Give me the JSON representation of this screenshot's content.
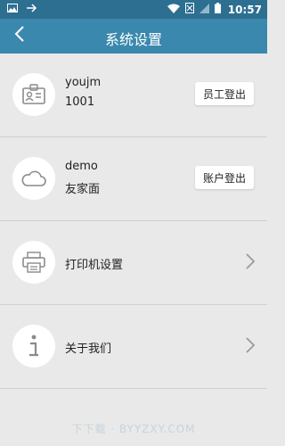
{
  "status_bar": {
    "time": "10:57",
    "icons": [
      "image-icon",
      "usb-icon",
      "wifi-icon",
      "sim-off-icon",
      "signal-icon",
      "battery-icon"
    ]
  },
  "header": {
    "title": "系统设置",
    "back_icon": "chevron-left-icon"
  },
  "items": [
    {
      "icon": "employee-card-icon",
      "line1": "youjm",
      "line2": "1001",
      "button": "员工登出"
    },
    {
      "icon": "cloud-icon",
      "line1": "demo",
      "line2": "友家面",
      "button": "账户登出"
    },
    {
      "icon": "printer-icon",
      "label": "打印机设置"
    },
    {
      "icon": "info-icon",
      "label": "关于我们"
    }
  ],
  "watermark": "下下载 · BYYZXY.COM",
  "colors": {
    "status_bar": "#2d6f91",
    "app_bar": "#3a88ad",
    "background": "#e9e9e9",
    "icon_gray": "#8a8a8a"
  }
}
